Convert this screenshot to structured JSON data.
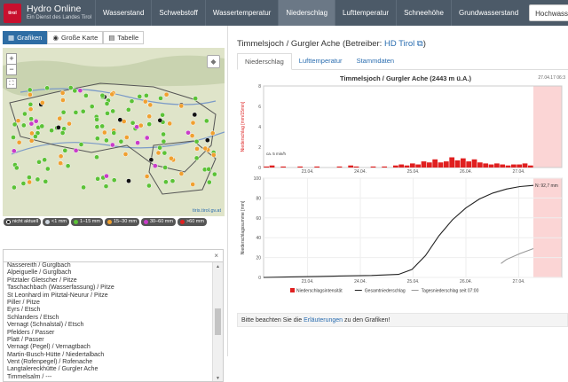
{
  "app": {
    "logo_text": "tirol",
    "title": "Hydro Online",
    "subtitle": "Ein Dienst des Landes Tirol"
  },
  "nav": [
    "Wasserstand",
    "Schwebstoff",
    "Wassertemperatur",
    "Niederschlag",
    "Lufttemperatur",
    "Schneehöhe",
    "Grundwasserstand",
    "Hochwasserinfo"
  ],
  "view_buttons": {
    "graphics": "Grafiken",
    "map": "Große Karte",
    "table": "Tabelle"
  },
  "map": {
    "zoom_in": "+",
    "zoom_out": "−",
    "credit": "tiris.tirol.gv.at"
  },
  "legend": [
    {
      "label": "nicht aktuell",
      "color": "#111111"
    },
    {
      "label": "<1 mm",
      "color": "#cfd7e0"
    },
    {
      "label": "1–15 mm",
      "color": "#5bc236"
    },
    {
      "label": "15–30 mm",
      "color": "#f0a030"
    },
    {
      "label": "30–60 mm",
      "color": "#c93cc8"
    },
    {
      "label": ">60 mm",
      "color": "#e02020"
    }
  ],
  "search": {
    "clear": "×"
  },
  "stations": [
    "Nassereith / Gurglbach",
    "Alpeiguelle / Gurglbach",
    "Pitztaler Gletscher / Pitze",
    "Taschachbach (Wasserfassung) / Pitze",
    "St Leonhard im Pitztal-Neurur / Pitze",
    "Piller / Pitze",
    "Eyrs / Etsch",
    "Schlanders / Etsch",
    "Vernagt (Schnalstal) / Etsch",
    "Pfelders / Passer",
    "Platt / Passer",
    "Vernagt (Pegel) / Vernagtbach",
    "Martin-Busch-Hütte / Niedertalbach",
    "Vent (Rofenpegel) / Rofenache",
    "Langtalereckhütte / Gurgler Ache",
    "Timmelsalm / ---",
    "Timmelsjoch / Gurgler Ache"
  ],
  "selected_station": "Timmelsjoch / Gurgler Ache",
  "detail": {
    "title_prefix": "Timmelsjoch / Gurgler Ache (Betreiber: ",
    "operator": "HD Tirol",
    "title_suffix": ")"
  },
  "tabs": [
    "Niederschlag",
    "Lufttemperatur",
    "Stammdaten"
  ],
  "note": {
    "before": "Bitte beachten Sie die ",
    "link": "Erläuterungen",
    "after": " zu den Grafiken!"
  },
  "chart_data": {
    "type": "line",
    "title": "Timmelsjoch / Gurgler Ache (2443 m ü.A.)",
    "timestamp": "27.04.17 06:3",
    "x_ticks": [
      "23.04.",
      "24.04.",
      "25.04.",
      "26.04.",
      "27.04."
    ],
    "top_panel": {
      "type": "bar",
      "ylabel": "Niederschlag [mm/15min]",
      "ylim": [
        0,
        8
      ],
      "y_ticks": [
        0,
        2,
        4,
        6,
        8
      ],
      "annotation": "ca. 5 min/h",
      "bars": [
        0.1,
        0.2,
        0,
        0.1,
        0,
        0,
        0.1,
        0,
        0,
        0.1,
        0,
        0,
        0,
        0.1,
        0,
        0.2,
        0.1,
        0,
        0,
        0.1,
        0,
        0.1,
        0,
        0.2,
        0.3,
        0.2,
        0.4,
        0.3,
        0.6,
        0.5,
        0.8,
        0.5,
        0.6,
        1.0,
        0.7,
        0.9,
        0.6,
        0.8,
        0.5,
        0.4,
        0.3,
        0.4,
        0.3,
        0.2,
        0.3,
        0.3,
        0.4,
        0.2
      ]
    },
    "bottom_panel": {
      "ylabel": "Niederschlagssumme [mm]",
      "ylim": [
        0,
        100
      ],
      "y_ticks": [
        0,
        20,
        40,
        60,
        80,
        100
      ],
      "max_label": "N: 92,7 mm",
      "series": [
        {
          "name": "Gesamtniederschlag",
          "color": "#222222",
          "x": [
            0,
            0.1,
            0.2,
            0.3,
            0.4,
            0.5,
            0.55,
            0.6,
            0.65,
            0.7,
            0.75,
            0.8,
            0.85,
            0.9,
            0.95,
            1.0
          ],
          "y": [
            0,
            0.5,
            1,
            1.5,
            2,
            3,
            8,
            22,
            42,
            58,
            70,
            79,
            85,
            89,
            91.5,
            92.7
          ]
        },
        {
          "name": "Tagesniederschlag seit 07:00",
          "color": "#999999",
          "x": [
            0.88,
            0.9,
            0.95,
            1.0
          ],
          "y": [
            14,
            18,
            24,
            29
          ]
        }
      ]
    },
    "legend": [
      {
        "label": "Niederschlagsintensität",
        "color": "#e02020"
      },
      {
        "label": "Gesamtniederschlag",
        "color": "#222222"
      },
      {
        "label": "Tagesniederschlag seit 07:00",
        "color": "#999999"
      }
    ]
  }
}
